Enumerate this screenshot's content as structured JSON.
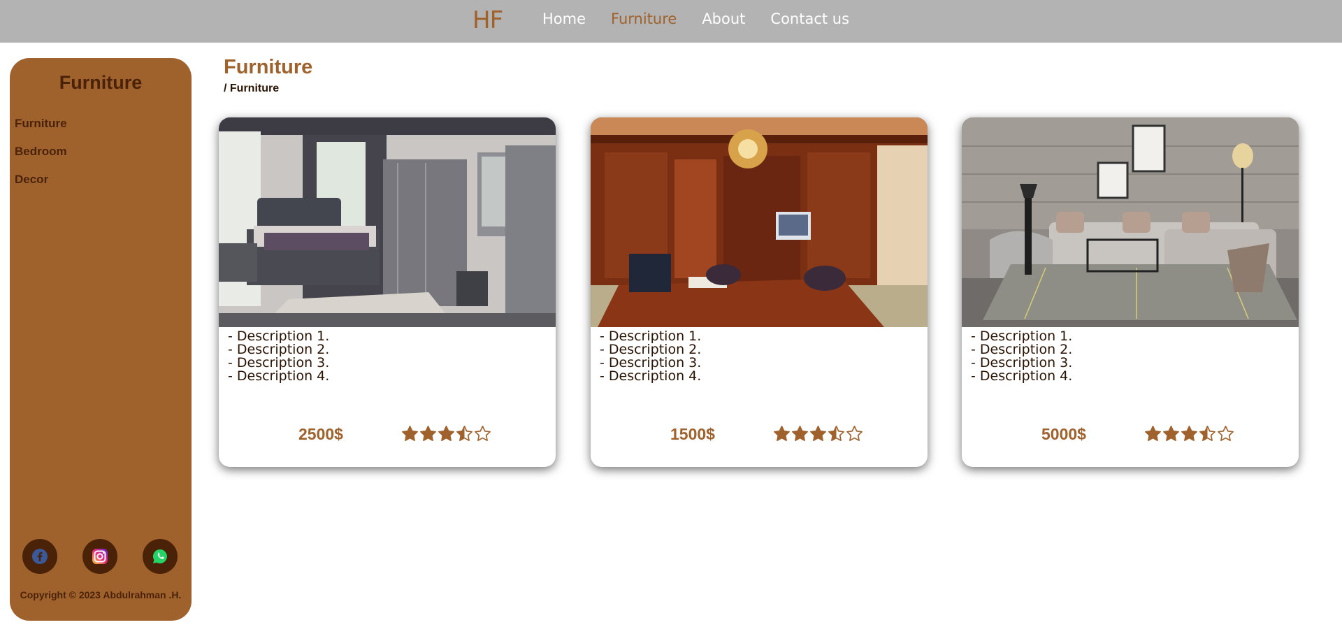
{
  "brand": {
    "logo": "HF"
  },
  "nav": {
    "items": [
      {
        "label": "Home",
        "active": false
      },
      {
        "label": "Furniture",
        "active": true
      },
      {
        "label": "About",
        "active": false
      },
      {
        "label": "Contact us",
        "active": false
      }
    ]
  },
  "sidebar": {
    "title": "Furniture",
    "links": [
      "Furniture",
      "Bedroom",
      "Decor"
    ],
    "socials": [
      "facebook-icon",
      "instagram-icon",
      "whatsapp-icon"
    ],
    "copyright": "Copyright © 2023 Abdulrahman .H."
  },
  "page": {
    "title": "Furniture",
    "breadcrumb": "/ Furniture"
  },
  "products": [
    {
      "image": "bedroom-photo",
      "descriptions": [
        "- Description 1.",
        "- Description 2.",
        "- Description 3.",
        "- Description 4."
      ],
      "price": "2500$",
      "rating": 3.5,
      "rating_max": 5
    },
    {
      "image": "office-photo",
      "descriptions": [
        "- Description 1.",
        "- Description 2.",
        "- Description 3.",
        "- Description 4."
      ],
      "price": "1500$",
      "rating": 3.5,
      "rating_max": 5
    },
    {
      "image": "living-room-photo",
      "descriptions": [
        "- Description 1.",
        "- Description 2.",
        "- Description 3.",
        "- Description 4."
      ],
      "price": "5000$",
      "rating": 3.5,
      "rating_max": 5
    }
  ],
  "colors": {
    "accent": "#a0622d",
    "dark": "#4a2207",
    "topbar": "#b3b3b3"
  }
}
